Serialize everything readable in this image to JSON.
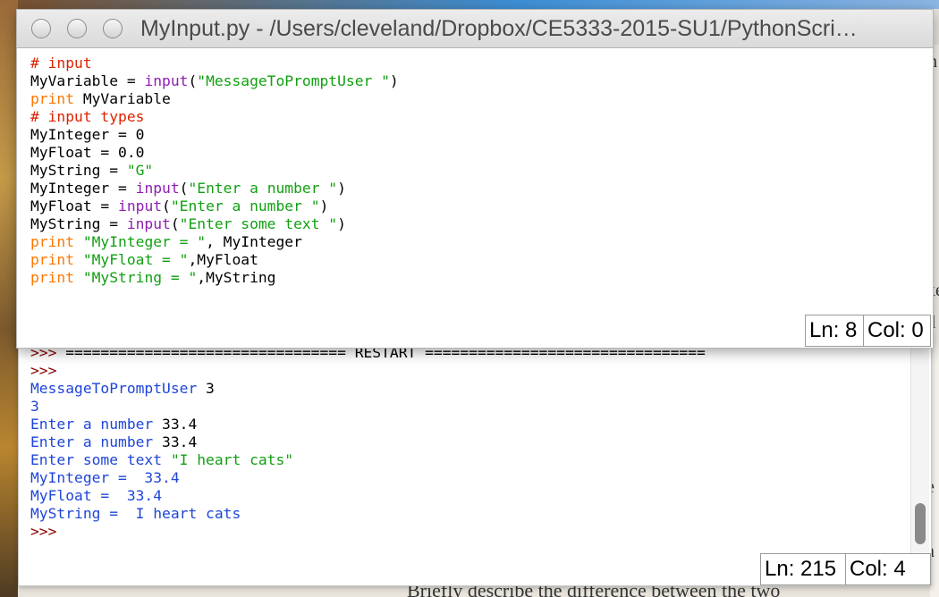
{
  "editor": {
    "title": "MyInput.py - /Users/cleveland/Dropbox/CE5333-2015-SU1/PythonScri…",
    "code_lines": [
      [
        {
          "c": "cmt",
          "t": "# input"
        }
      ],
      [
        {
          "c": "",
          "t": "MyVariable = "
        },
        {
          "c": "bi",
          "t": "input"
        },
        {
          "c": "",
          "t": "("
        },
        {
          "c": "str",
          "t": "\"MessageToPromptUser \""
        },
        {
          "c": "",
          "t": ")"
        }
      ],
      [
        {
          "c": "kw",
          "t": "print"
        },
        {
          "c": "",
          "t": " MyVariable"
        }
      ],
      [
        {
          "c": "cmt",
          "t": "# input types"
        }
      ],
      [
        {
          "c": "",
          "t": "MyInteger = 0"
        }
      ],
      [
        {
          "c": "",
          "t": "MyFloat = 0.0"
        }
      ],
      [
        {
          "c": "",
          "t": "MyString = "
        },
        {
          "c": "str",
          "t": "\"G\""
        }
      ],
      [
        {
          "c": "",
          "t": "MyInteger = "
        },
        {
          "c": "bi",
          "t": "input"
        },
        {
          "c": "",
          "t": "("
        },
        {
          "c": "str",
          "t": "\"Enter a number \""
        },
        {
          "c": "",
          "t": ")"
        }
      ],
      [
        {
          "c": "",
          "t": "MyFloat = "
        },
        {
          "c": "bi",
          "t": "input"
        },
        {
          "c": "",
          "t": "("
        },
        {
          "c": "str",
          "t": "\"Enter a number \""
        },
        {
          "c": "",
          "t": ")"
        }
      ],
      [
        {
          "c": "",
          "t": "MyString = "
        },
        {
          "c": "bi",
          "t": "input"
        },
        {
          "c": "",
          "t": "("
        },
        {
          "c": "str",
          "t": "\"Enter some text \""
        },
        {
          "c": "",
          "t": ")"
        }
      ],
      [
        {
          "c": "kw",
          "t": "print"
        },
        {
          "c": "",
          "t": " "
        },
        {
          "c": "str",
          "t": "\"MyInteger = \""
        },
        {
          "c": "",
          "t": ", MyInteger"
        }
      ],
      [
        {
          "c": "kw",
          "t": "print"
        },
        {
          "c": "",
          "t": " "
        },
        {
          "c": "str",
          "t": "\"MyFloat = \""
        },
        {
          "c": "",
          "t": ",MyFloat"
        }
      ],
      [
        {
          "c": "kw",
          "t": "print"
        },
        {
          "c": "",
          "t": " "
        },
        {
          "c": "str",
          "t": "\"MyString = \""
        },
        {
          "c": "",
          "t": ",MyString"
        }
      ]
    ],
    "status": {
      "ln": "Ln: 8",
      "col": "Col: 0"
    }
  },
  "shell": {
    "lines": [
      [
        {
          "c": "prompt",
          "t": ">>> "
        },
        {
          "c": "restart",
          "t": "================================ RESTART ================================"
        }
      ],
      [
        {
          "c": "prompt",
          "t": ">>>"
        }
      ],
      [
        {
          "c": "out",
          "t": "MessageToPromptUser "
        },
        {
          "c": "",
          "t": "3"
        }
      ],
      [
        {
          "c": "out",
          "t": "3"
        }
      ],
      [
        {
          "c": "out",
          "t": "Enter a number "
        },
        {
          "c": "",
          "t": "33.4"
        }
      ],
      [
        {
          "c": "out",
          "t": "Enter a number "
        },
        {
          "c": "",
          "t": "33.4"
        }
      ],
      [
        {
          "c": "out",
          "t": "Enter some text "
        },
        {
          "c": "sh-str",
          "t": "\"I heart cats\""
        }
      ],
      [
        {
          "c": "out",
          "t": "MyInteger =  33.4"
        }
      ],
      [
        {
          "c": "out",
          "t": "MyFloat =  33.4"
        }
      ],
      [
        {
          "c": "out",
          "t": "MyString =  I heart cats"
        }
      ],
      [
        {
          "c": "prompt",
          "t": ">>>"
        }
      ]
    ],
    "status": {
      "ln": "Ln: 215",
      "col": "Col: 4"
    }
  },
  "background": {
    "doc_fragments": [
      "h",
      "xe",
      "d '",
      "e",
      "a"
    ],
    "bottom_text": "Briefly describe the difference between the two"
  }
}
